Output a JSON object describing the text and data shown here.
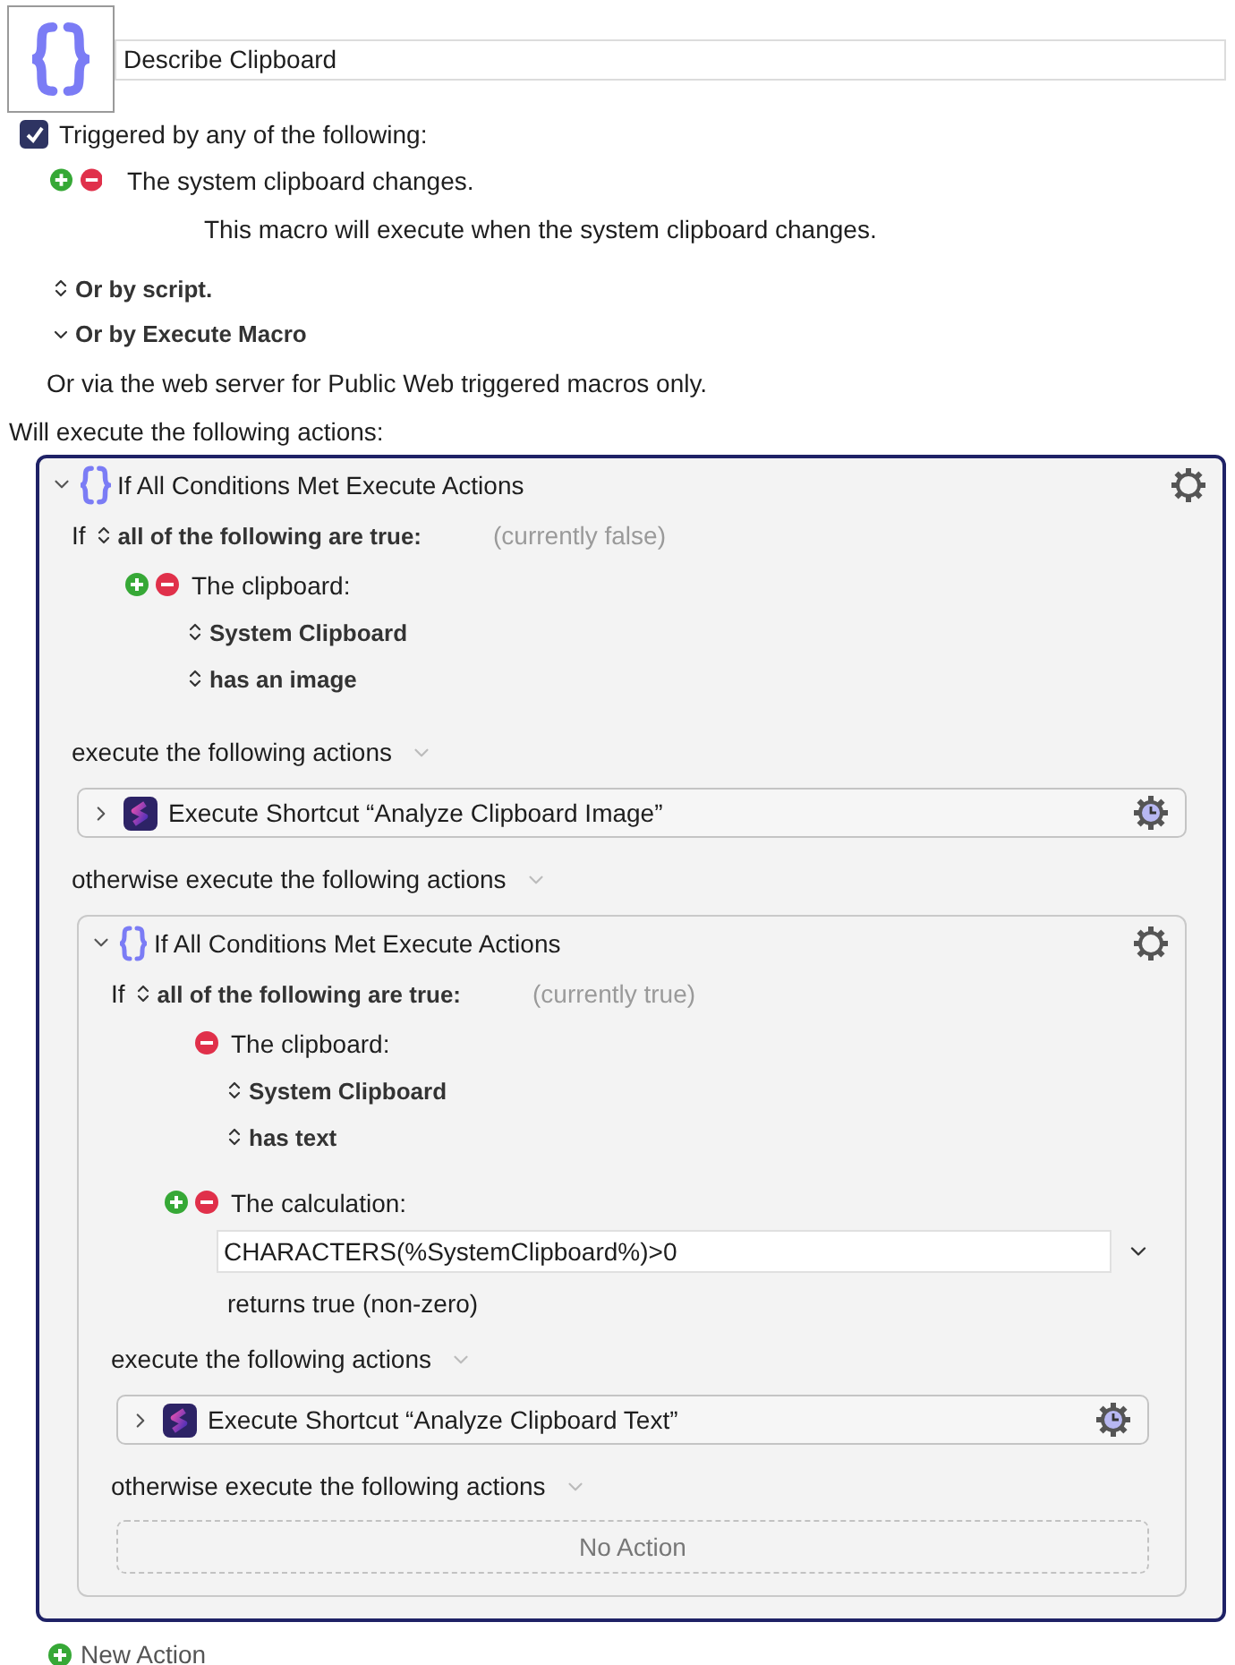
{
  "macro": {
    "name": "Describe Clipboard"
  },
  "trigger": {
    "enabled": true,
    "label": "Triggered by any of the following:",
    "items": [
      {
        "text": "The system clipboard changes.",
        "description": "This macro will execute when the system clipboard changes."
      }
    ],
    "options": [
      {
        "label": "Or by script.",
        "expanded": false
      },
      {
        "label": "Or by Execute Macro",
        "expanded": true
      }
    ],
    "web_note": "Or via the web server for Public Web triggered macros only."
  },
  "actions_heading": "Will execute the following actions:",
  "actions": [
    {
      "kind": "if",
      "title": "If All Conditions Met Execute Actions",
      "expanded": true,
      "selected": true,
      "if_word": "If",
      "mode": "all of the following are true:",
      "status": "(currently false)",
      "conditions": [
        {
          "kind": "clipboard",
          "label": "The clipboard:",
          "can_add": true,
          "fields": [
            "System Clipboard",
            "has an image"
          ]
        }
      ],
      "then_label": "execute the following actions",
      "then_actions": [
        {
          "kind": "shortcut",
          "title": "Execute Shortcut “Analyze Clipboard Image”",
          "expanded": false,
          "selected": false
        }
      ],
      "else_label": "otherwise execute the following actions",
      "else_actions": [
        {
          "kind": "if",
          "title": "If All Conditions Met Execute Actions",
          "expanded": true,
          "selected": false,
          "if_word": "If",
          "mode": "all of the following are true:",
          "status": "(currently true)",
          "conditions": [
            {
              "kind": "clipboard",
              "label": "The clipboard:",
              "can_add": false,
              "fields": [
                "System Clipboard",
                "has text"
              ]
            },
            {
              "kind": "calculation",
              "label": "The calculation:",
              "can_add": true,
              "value": "CHARACTERS(%SystemClipboard%)>0",
              "result": "returns true (non-zero)"
            }
          ],
          "then_label": "execute the following actions",
          "then_actions": [
            {
              "kind": "shortcut",
              "title": "Execute Shortcut “Analyze Clipboard Text”",
              "expanded": false,
              "selected": false
            }
          ],
          "else_label": "otherwise execute the following actions",
          "empty_label": "No Action"
        }
      ]
    }
  ],
  "new_action": "New Action"
}
